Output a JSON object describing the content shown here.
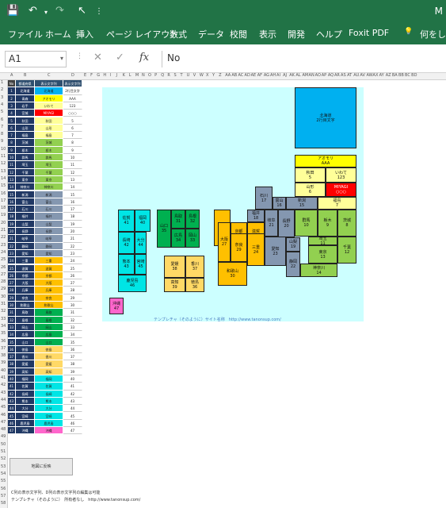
{
  "titlebar": {
    "title": "M"
  },
  "ribbon": {
    "tabs": [
      "ファイル",
      "ホーム",
      "挿入",
      "ページ レイアウト",
      "数式",
      "データ",
      "校閲",
      "表示",
      "開発",
      "ヘルプ",
      "Foxit PDF",
      "何をしま"
    ]
  },
  "formula_bar": {
    "cell_ref": "A1",
    "formula": "No"
  },
  "columns": [
    "A",
    "B",
    "C",
    "D",
    "E",
    "F",
    "G",
    "H",
    "I",
    "J",
    "K",
    "L",
    "M",
    "N",
    "O",
    "P",
    "Q",
    "R",
    "S",
    "T",
    "U",
    "V",
    "W",
    "X",
    "Y",
    "Z",
    "AA",
    "AB",
    "AC",
    "AD",
    "AE",
    "AF",
    "AG",
    "AH",
    "AI",
    "AJ",
    "AK",
    "AL",
    "AM",
    "AN",
    "AO",
    "AP",
    "AQ",
    "AR",
    "AS",
    "AT",
    "AU",
    "AV",
    "AW",
    "AX",
    "AY",
    "AZ",
    "BA",
    "BB",
    "BC",
    "BD"
  ],
  "table": {
    "headers": [
      "No",
      "都道府県",
      "表示文字列",
      "表示文字列"
    ],
    "rows": [
      [
        "1",
        "北海道",
        "北海道",
        "2行目文字"
      ],
      [
        "2",
        "青森",
        "アオモリ",
        "AAA"
      ],
      [
        "3",
        "岩手",
        "いわて",
        "123"
      ],
      [
        "4",
        "宮城",
        "MIYAGI",
        "○○○"
      ],
      [
        "5",
        "秋田",
        "秋田",
        "5"
      ],
      [
        "6",
        "山形",
        "山形",
        "6"
      ],
      [
        "7",
        "福島",
        "福島",
        "7"
      ],
      [
        "8",
        "茨城",
        "茨城",
        "8"
      ],
      [
        "9",
        "栃木",
        "栃木",
        "9"
      ],
      [
        "10",
        "群馬",
        "群馬",
        "10"
      ],
      [
        "11",
        "埼玉",
        "埼玉",
        "11"
      ],
      [
        "12",
        "千葉",
        "千葉",
        "12"
      ],
      [
        "13",
        "東京",
        "東京",
        "13"
      ],
      [
        "14",
        "神奈川",
        "神奈川",
        "14"
      ],
      [
        "15",
        "新潟",
        "新潟",
        "15"
      ],
      [
        "16",
        "富山",
        "富山",
        "16"
      ],
      [
        "17",
        "石川",
        "石川",
        "17"
      ],
      [
        "18",
        "福井",
        "福井",
        "18"
      ],
      [
        "19",
        "山梨",
        "山梨",
        "19"
      ],
      [
        "20",
        "長野",
        "長野",
        "20"
      ],
      [
        "21",
        "岐阜",
        "岐阜",
        "21"
      ],
      [
        "22",
        "静岡",
        "静岡",
        "22"
      ],
      [
        "23",
        "愛知",
        "愛知",
        "23"
      ],
      [
        "24",
        "三重",
        "三重",
        "24"
      ],
      [
        "25",
        "滋賀",
        "滋賀",
        "25"
      ],
      [
        "26",
        "京都",
        "京都",
        "26"
      ],
      [
        "27",
        "大阪",
        "大阪",
        "27"
      ],
      [
        "28",
        "兵庫",
        "兵庫",
        "28"
      ],
      [
        "29",
        "奈良",
        "奈良",
        "29"
      ],
      [
        "30",
        "和歌山",
        "和歌山",
        "30"
      ],
      [
        "31",
        "鳥取",
        "鳥取",
        "31"
      ],
      [
        "32",
        "島根",
        "島根",
        "32"
      ],
      [
        "33",
        "岡山",
        "岡山",
        "33"
      ],
      [
        "34",
        "広島",
        "広島",
        "34"
      ],
      [
        "35",
        "山口",
        "山口",
        "35"
      ],
      [
        "36",
        "徳島",
        "徳島",
        "36"
      ],
      [
        "37",
        "香川",
        "香川",
        "37"
      ],
      [
        "38",
        "愛媛",
        "愛媛",
        "38"
      ],
      [
        "39",
        "高知",
        "高知",
        "39"
      ],
      [
        "40",
        "福岡",
        "福岡",
        "40"
      ],
      [
        "41",
        "佐賀",
        "佐賀",
        "41"
      ],
      [
        "42",
        "長崎",
        "長崎",
        "42"
      ],
      [
        "43",
        "熊本",
        "熊本",
        "43"
      ],
      [
        "44",
        "大分",
        "大分",
        "44"
      ],
      [
        "45",
        "宮崎",
        "宮崎",
        "45"
      ],
      [
        "46",
        "鹿児島",
        "鹿児島",
        "46"
      ],
      [
        "47",
        "沖縄",
        "沖縄",
        "47"
      ]
    ]
  },
  "colors": {
    "hokkaido": "#00b0f0",
    "tohoku": "#ffff99",
    "kanto": "#92d050",
    "chubu": "#8497b0",
    "kinki": "#ffc000",
    "chugoku": "#00b050",
    "shikoku": "#ffd966",
    "kyushu": "#00e5e5",
    "okinawa": "#ff66cc",
    "miyagi": "#ff0000",
    "aomori": "#ffff00"
  },
  "map": {
    "prefs": [
      {
        "label": "北海道",
        "num": "2行目文字",
        "region": "hokkaido"
      },
      {
        "label": "アオモリ",
        "num": "AAA",
        "region": "aomori"
      },
      {
        "label": "秋田",
        "num": "5",
        "region": "tohoku"
      },
      {
        "label": "いわて",
        "num": "123",
        "region": "tohoku"
      },
      {
        "label": "山形",
        "num": "6",
        "region": "tohoku"
      },
      {
        "label": "MIYAGI",
        "num": "○○○",
        "region": "miyagi"
      },
      {
        "label": "福島",
        "num": "7",
        "region": "tohoku"
      },
      {
        "label": "石川",
        "num": "17",
        "region": "chubu"
      },
      {
        "label": "富山",
        "num": "16",
        "region": "chubu"
      },
      {
        "label": "新潟",
        "num": "15",
        "region": "chubu"
      },
      {
        "label": "群馬",
        "num": "10",
        "region": "kanto"
      },
      {
        "label": "栃木",
        "num": "9",
        "region": "kanto"
      },
      {
        "label": "茨城",
        "num": "8",
        "region": "kanto"
      },
      {
        "label": "埼玉",
        "num": "11",
        "region": "kanto"
      },
      {
        "label": "東京",
        "num": "13",
        "region": "kanto"
      },
      {
        "label": "千葉",
        "num": "12",
        "region": "kanto"
      },
      {
        "label": "神奈川",
        "num": "14",
        "region": "kanto"
      },
      {
        "label": "福井",
        "num": "18",
        "region": "chubu"
      },
      {
        "label": "長野",
        "num": "20",
        "region": "chubu"
      },
      {
        "label": "岐阜",
        "num": "21",
        "region": "chubu"
      },
      {
        "label": "山梨",
        "num": "19",
        "region": "chubu"
      },
      {
        "label": "愛知",
        "num": "23",
        "region": "chubu"
      },
      {
        "label": "静岡",
        "num": "22",
        "region": "chubu"
      },
      {
        "label": "京都",
        "num": "26",
        "region": "kinki"
      },
      {
        "label": "滋賀",
        "num": "25",
        "region": "kinki"
      },
      {
        "label": "兵庫",
        "num": "28",
        "region": "kinki"
      },
      {
        "label": "大阪",
        "num": "27",
        "region": "kinki"
      },
      {
        "label": "奈良",
        "num": "29",
        "region": "kinki"
      },
      {
        "label": "三重",
        "num": "24",
        "region": "kinki"
      },
      {
        "label": "和歌山",
        "num": "30",
        "region": "kinki"
      },
      {
        "label": "鳥取",
        "num": "31",
        "region": "chugoku"
      },
      {
        "label": "島根",
        "num": "32",
        "region": "chugoku"
      },
      {
        "label": "岡山",
        "num": "33",
        "region": "chugoku"
      },
      {
        "label": "広島",
        "num": "34",
        "region": "chugoku"
      },
      {
        "label": "山口",
        "num": "35",
        "region": "chugoku"
      },
      {
        "label": "香川",
        "num": "37",
        "region": "shikoku"
      },
      {
        "label": "愛媛",
        "num": "38",
        "region": "shikoku"
      },
      {
        "label": "徳島",
        "num": "36",
        "region": "shikoku"
      },
      {
        "label": "高知",
        "num": "39",
        "region": "shikoku"
      },
      {
        "label": "福岡",
        "num": "40",
        "region": "kyushu"
      },
      {
        "label": "佐賀",
        "num": "41",
        "region": "kyushu"
      },
      {
        "label": "長崎",
        "num": "42",
        "region": "kyushu"
      },
      {
        "label": "大分",
        "num": "44",
        "region": "kyushu"
      },
      {
        "label": "熊本",
        "num": "43",
        "region": "kyushu"
      },
      {
        "label": "宮崎",
        "num": "45",
        "region": "kyushu"
      },
      {
        "label": "鹿児島",
        "num": "46",
        "region": "kyushu"
      },
      {
        "label": "沖縄",
        "num": "47",
        "region": "okinawa"
      }
    ],
    "credit": "テンプレチャ（そのように）サイト名称　http://www.tanonsup.com/"
  },
  "button": {
    "label": "地図に反映"
  },
  "notes": [
    "C列の表示文字列、D列の表示文字列の編集は可能",
    "テンプレチャ（そのように）　所有者なし　http://www.tanonsup.com/"
  ]
}
